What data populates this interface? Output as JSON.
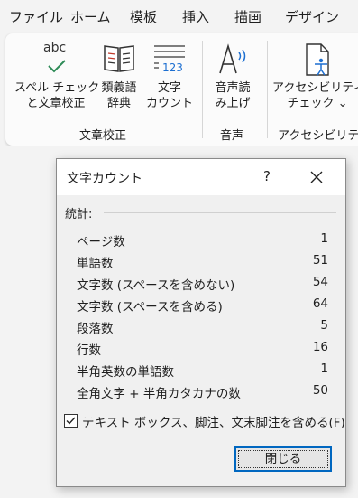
{
  "menu": [
    "ファイル",
    "ホーム",
    "模板",
    "挿入",
    "描画",
    "デザイン"
  ],
  "ribbon": {
    "proofing": {
      "spell_icon_text": "abc",
      "spell_line1": "スペル チェック",
      "spell_line2": "と文章校正",
      "thes_line1": "類義語",
      "thes_line2": "辞典",
      "wc_icon_text": "123",
      "wc_line1": "文字",
      "wc_line2": "カウント",
      "group_label": "文章校正"
    },
    "speech": {
      "read_line1": "音声読",
      "read_line2": "み上げ",
      "group_label": "音声"
    },
    "accessibility": {
      "check_line1": "アクセシビリティ",
      "check_line2": "チェック ⌄",
      "group_label": "アクセシビリティ"
    }
  },
  "dialog": {
    "title": "文字カウント",
    "help_glyph": "?",
    "stats_label": "統計:",
    "stats": [
      {
        "label": "ページ数",
        "value": "1"
      },
      {
        "label": "単語数",
        "value": "51"
      },
      {
        "label": "文字数 (スペースを含めない)",
        "value": "54"
      },
      {
        "label": "文字数 (スペースを含める)",
        "value": "64"
      },
      {
        "label": "段落数",
        "value": "5"
      },
      {
        "label": "行数",
        "value": "16"
      },
      {
        "label": "半角英数の単語数",
        "value": "1"
      },
      {
        "label": "全角文字 + 半角カタカナの数",
        "value": "50"
      }
    ],
    "checkbox_label": "テキスト ボックス、脚注、文末脚注を含める(F)",
    "checkbox_checked": true,
    "close_button": "閉じる"
  },
  "colors": {
    "accent": "#0067c0",
    "icon_green": "#2e8b57",
    "icon_blue": "#1d6fd1"
  },
  "icons": [
    "checkmark-icon",
    "dictionary-icon",
    "word-count-icon",
    "read-aloud-icon",
    "accessibility-icon",
    "close-icon",
    "check-icon"
  ]
}
